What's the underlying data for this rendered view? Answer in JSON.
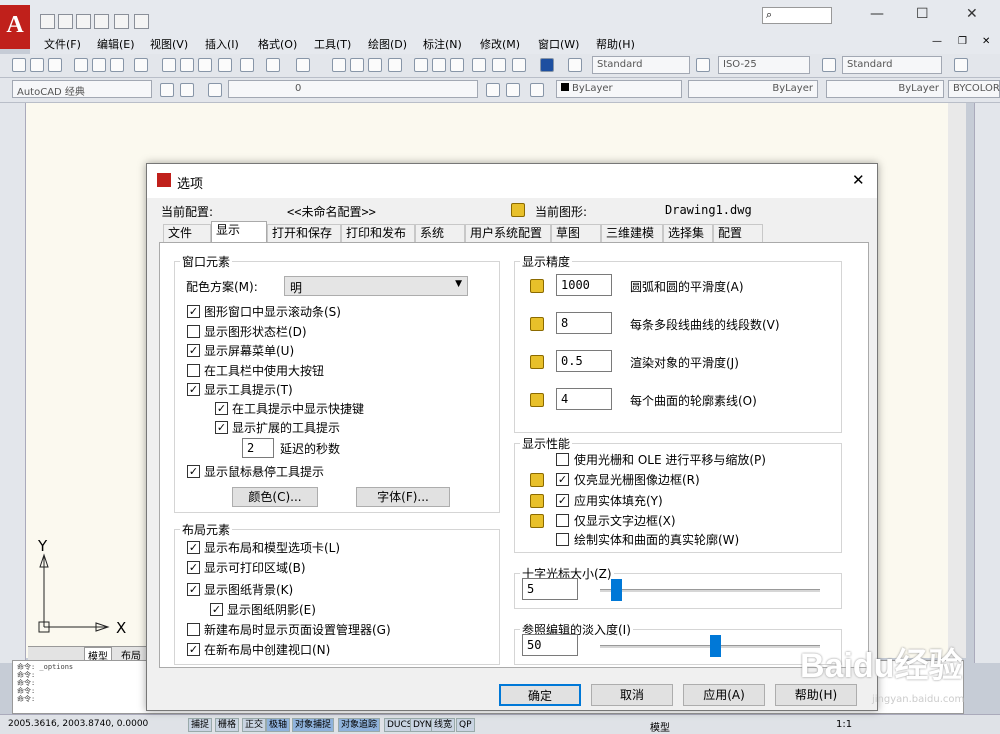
{
  "app": {
    "logo": "A",
    "help_search": "⌕"
  },
  "menubar": [
    "文件(F)",
    "编辑(E)",
    "视图(V)",
    "插入(I)",
    "格式(O)",
    "工具(T)",
    "绘图(D)",
    "标注(N)",
    "修改(M)",
    "窗口(W)",
    "帮助(H)"
  ],
  "toolbar1": {
    "text_style": "Standard",
    "dim_style": "ISO-25",
    "table_style": "Standard"
  },
  "toolbar2": {
    "workspace": "AutoCAD 经典",
    "layer": "0",
    "color": "ByLayer",
    "linetype": "ByLayer",
    "lineweight": "ByLayer",
    "plotstyle": "BYCOLOR"
  },
  "layout_tabs": [
    "模型",
    "布局1"
  ],
  "ucs": {
    "y": "Y",
    "x": "X"
  },
  "cmdline": [
    "命令: _options",
    "命令:",
    "命令:",
    "命令:",
    "命令:"
  ],
  "status": {
    "coords": "2005.3616, 2003.8740, 0.0000",
    "buttons": [
      "捕捉",
      "栅格",
      "正交",
      "极轴",
      "对象捕捉",
      "对象追踪",
      "DUCS",
      "DYN",
      "线宽",
      "QP"
    ],
    "model": "模型",
    "scale": "1:1"
  },
  "dialog": {
    "title": "选项",
    "close": "✕",
    "profile_label": "当前配置:",
    "profile_value": "<<未命名配置>>",
    "drawing_label": "当前图形:",
    "drawing_value": "Drawing1.dwg",
    "tabs": [
      "文件",
      "显示",
      "打开和保存",
      "打印和发布",
      "系统",
      "用户系统配置",
      "草图",
      "三维建模",
      "选择集",
      "配置"
    ],
    "window": {
      "title": "窗口元素",
      "scheme_label": "配色方案(M):",
      "scheme_value": "明",
      "items": [
        {
          "label": "图形窗口中显示滚动条(S)",
          "checked": true
        },
        {
          "label": "显示图形状态栏(D)",
          "checked": false
        },
        {
          "label": "显示屏幕菜单(U)",
          "checked": true
        },
        {
          "label": "在工具栏中使用大按钮",
          "checked": false
        },
        {
          "label": "显示工具提示(T)",
          "checked": true
        },
        {
          "label": "在工具提示中显示快捷键",
          "checked": true
        },
        {
          "label": "显示扩展的工具提示",
          "checked": true
        },
        {
          "label": "显示鼠标悬停工具提示",
          "checked": true
        }
      ],
      "delay_value": "2",
      "delay_label": "延迟的秒数",
      "colors_btn": "颜色(C)...",
      "fonts_btn": "字体(F)..."
    },
    "layout": {
      "title": "布局元素",
      "items": [
        {
          "label": "显示布局和模型选项卡(L)",
          "checked": true
        },
        {
          "label": "显示可打印区域(B)",
          "checked": true
        },
        {
          "label": "显示图纸背景(K)",
          "checked": true
        },
        {
          "label": "显示图纸阴影(E)",
          "checked": true
        },
        {
          "label": "新建布局时显示页面设置管理器(G)",
          "checked": false
        },
        {
          "label": "在新布局中创建视口(N)",
          "checked": true
        }
      ]
    },
    "precision": {
      "title": "显示精度",
      "rows": [
        {
          "value": "1000",
          "label": "圆弧和圆的平滑度(A)"
        },
        {
          "value": "8",
          "label": "每条多段线曲线的线段数(V)"
        },
        {
          "value": "0.5",
          "label": "渲染对象的平滑度(J)"
        },
        {
          "value": "4",
          "label": "每个曲面的轮廓素线(O)"
        }
      ]
    },
    "performance": {
      "title": "显示性能",
      "items": [
        {
          "label": "使用光栅和 OLE 进行平移与缩放(P)",
          "checked": false
        },
        {
          "label": "仅亮显光栅图像边框(R)",
          "checked": true
        },
        {
          "label": "应用实体填充(Y)",
          "checked": true
        },
        {
          "label": "仅显示文字边框(X)",
          "checked": false
        },
        {
          "label": "绘制实体和曲面的真实轮廓(W)",
          "checked": false
        }
      ]
    },
    "crosshair": {
      "title": "十字光标大小(Z)",
      "value": "5",
      "fraction": 0.05
    },
    "xref": {
      "title": "参照编辑的淡入度(I)",
      "value": "50",
      "fraction": 0.5
    },
    "buttons": {
      "ok": "确定",
      "cancel": "取消",
      "apply": "应用(A)",
      "help": "帮助(H)"
    }
  },
  "watermark": {
    "brand": "Baidu经验",
    "url": "jingyan.baidu.com"
  },
  "colors": {
    "accent": "#0078d7",
    "logo": "#c0201b",
    "arrow": "#e0393a"
  }
}
